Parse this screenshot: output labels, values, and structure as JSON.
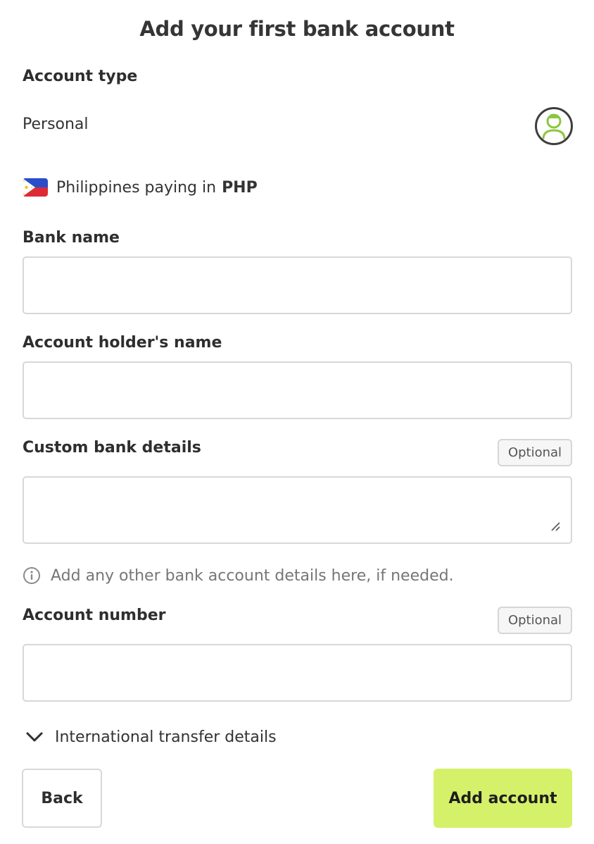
{
  "title": "Add your first bank account",
  "account_type": {
    "label": "Account type",
    "value": "Personal",
    "icon": "user-avatar-icon",
    "accent_color": "#8cc63f"
  },
  "country": {
    "flag_icon": "philippines-flag-icon",
    "text": "Philippines paying in",
    "currency": "PHP"
  },
  "fields": {
    "bank_name": {
      "label": "Bank name",
      "value": "",
      "placeholder": ""
    },
    "holder_name": {
      "label": "Account holder's name",
      "value": "",
      "placeholder": ""
    },
    "custom_details": {
      "label": "Custom bank details",
      "badge": "Optional",
      "value": "",
      "placeholder": "",
      "helper": "Add any other bank account details here, if needed."
    },
    "account_number": {
      "label": "Account number",
      "badge": "Optional",
      "value": "",
      "placeholder": ""
    }
  },
  "international": {
    "label": "International transfer details",
    "icon": "chevron-down-icon"
  },
  "buttons": {
    "back": "Back",
    "add": "Add account",
    "add_color": "#d5f16a"
  }
}
